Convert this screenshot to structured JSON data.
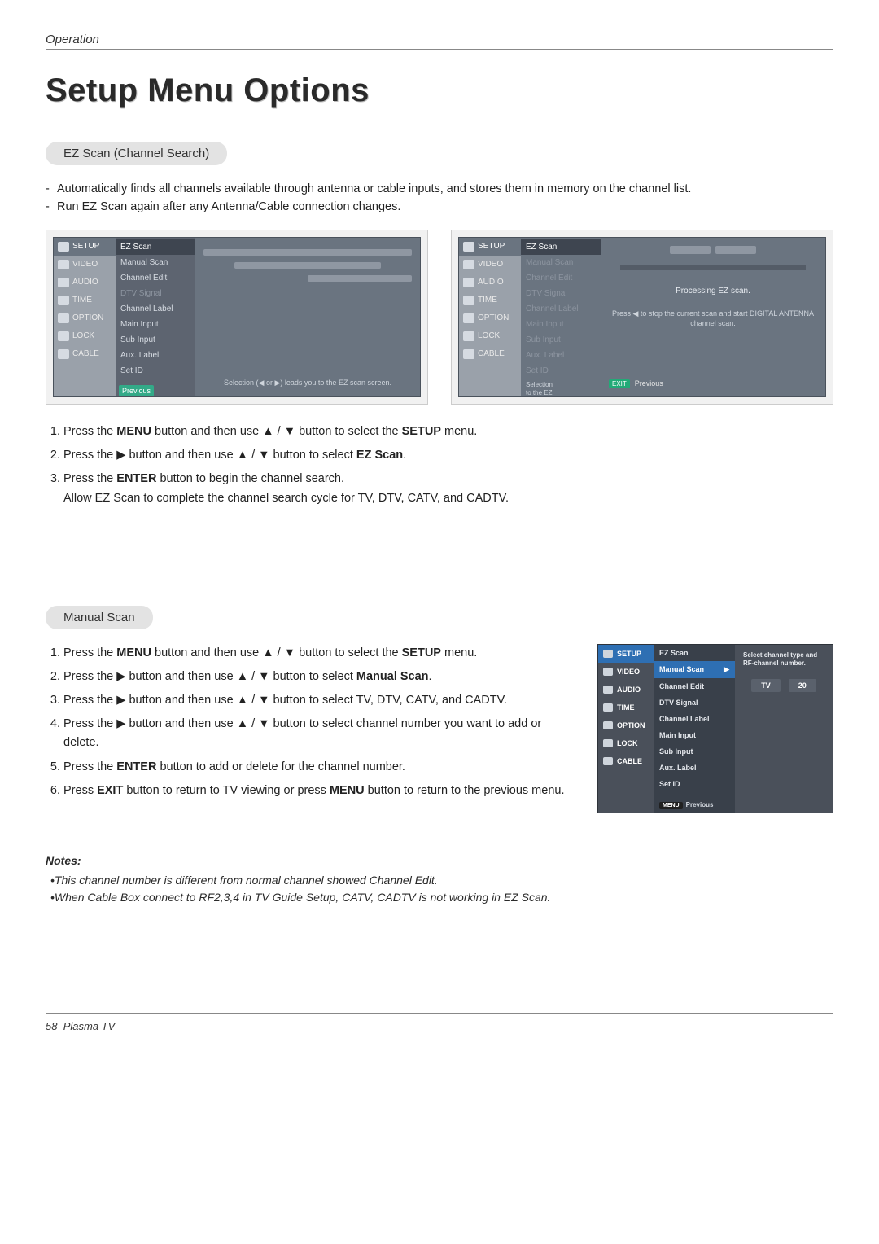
{
  "header": {
    "section": "Operation"
  },
  "title": "Setup Menu Options",
  "ezscan": {
    "pill": "EZ Scan (Channel Search)",
    "bullets": [
      "Automatically finds all channels available through antenna or cable inputs, and stores them in memory on the channel list.",
      "Run EZ Scan again after any Antenna/Cable connection changes."
    ],
    "osd_side": [
      "SETUP",
      "VIDEO",
      "AUDIO",
      "TIME",
      "OPTION",
      "LOCK",
      "CABLE"
    ],
    "osd_list": [
      "EZ Scan",
      "Manual Scan",
      "Channel Edit",
      "DTV Signal",
      "Channel Label",
      "Main Input",
      "Sub Input",
      "Aux. Label",
      "Set ID"
    ],
    "osd_side_foot": "Previous",
    "osd1_hint": "Selection (◀ or ▶) leads you to the EZ scan screen.",
    "osd2_proc": "Processing EZ scan.",
    "osd2_side_note_a": "Selection",
    "osd2_side_note_b": "to the EZ",
    "osd2_note": "Press ◀ to stop the current scan and start DIGITAL ANTENNA channel scan.",
    "osd2_prev_key": "EXIT",
    "osd2_prev": "Previous",
    "steps": {
      "s1a": "Press the ",
      "s1b": "MENU",
      "s1c": " button and then use ",
      "s1d": " button to select the ",
      "s1e": "SETUP",
      "s1f": " menu.",
      "s2a": "Press the ",
      "s2b": " button and then use ",
      "s2c": " button to select ",
      "s2d": "EZ Scan",
      "s2e": ".",
      "s3a": "Press the ",
      "s3b": "ENTER",
      "s3c": " button to begin the channel search.",
      "s3sub": "Allow EZ Scan to complete the channel search cycle for TV, DTV, CATV, and CADTV."
    }
  },
  "manual": {
    "pill": "Manual Scan",
    "steps": {
      "s1a": "Press the ",
      "s1b": "MENU",
      "s1c": " button and then use ",
      "s1d": " button to select the ",
      "s1e": "SETUP",
      "s1f": " menu.",
      "s2a": "Press the ",
      "s2b": " button and then use ",
      "s2c": " button to select ",
      "s2d": "Manual Scan",
      "s2e": ".",
      "s3a": "Press the ",
      "s3b": " button and then use ",
      "s3c": " button to select TV, DTV, CATV, and CADTV.",
      "s4a": "Press the ",
      "s4b": " button and then use ",
      "s4c": " button to select channel number you want to add or delete.",
      "s5a": "Press the  ",
      "s5b": "ENTER",
      "s5c": "  button to add or delete for the channel number.",
      "s6a": "Press ",
      "s6b": "EXIT",
      "s6c": " button to return to TV viewing or press ",
      "s6d": "MENU",
      "s6e": " button to return to the previous menu."
    },
    "dosd_side": [
      "SETUP",
      "VIDEO",
      "AUDIO",
      "TIME",
      "OPTION",
      "LOCK",
      "CABLE"
    ],
    "dosd_list": [
      "EZ Scan",
      "Manual Scan",
      "Channel Edit",
      "DTV Signal",
      "Channel Label",
      "Main Input",
      "Sub Input",
      "Aux. Label",
      "Set ID"
    ],
    "dosd_foot_key": "MENU",
    "dosd_foot_label": "Previous",
    "dosd_hint": "Select channel type and RF-channel number.",
    "dosd_tv": "TV",
    "dosd_num": "20"
  },
  "notes": {
    "heading": "Notes:",
    "items": [
      "•This channel number is different from normal channel showed Channel Edit.",
      "•When Cable Box connect to RF2,3,4 in TV Guide Setup, CATV, CADTV is not working in EZ Scan."
    ]
  },
  "footer": {
    "page": "58",
    "label": "Plasma TV"
  },
  "glyphs": {
    "up": "▲",
    "down": "▼",
    "right": "▶",
    "sep": " / "
  }
}
